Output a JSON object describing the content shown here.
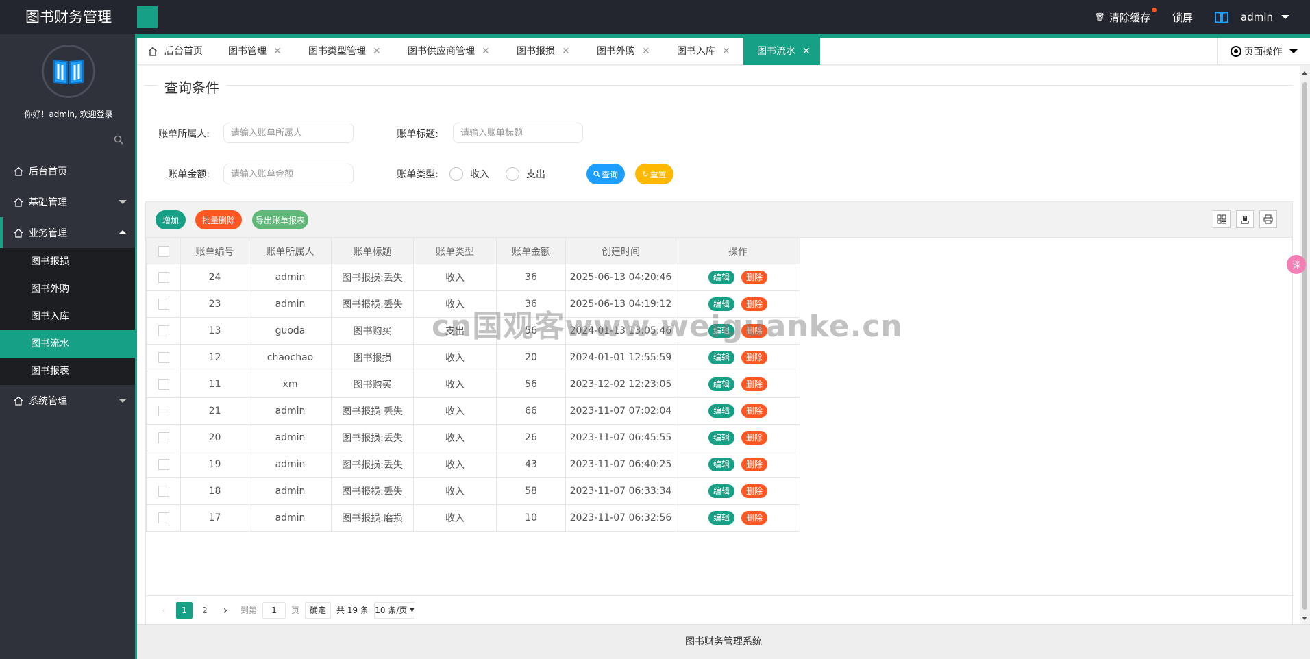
{
  "header": {
    "title": "图书财务管理",
    "clear_cache": "清除缓存",
    "lock_screen": "锁屏",
    "user": "admin"
  },
  "sidebar": {
    "welcome": "你好！admin, 欢迎登录",
    "menu": {
      "home": "后台首页",
      "basic": "基础管理",
      "business": "业务管理",
      "children": [
        "图书报损",
        "图书外购",
        "图书入库",
        "图书流水",
        "图书报表"
      ],
      "system": "系统管理"
    }
  },
  "tabs": [
    "后台首页",
    "图书管理",
    "图书类型管理",
    "图书供应商管理",
    "图书报损",
    "图书外购",
    "图书入库",
    "图书流水"
  ],
  "page_op": "页面操作",
  "query": {
    "legend": "查询条件",
    "owner_label": "账单所属人:",
    "owner_placeholder": "请输入账单所属人",
    "title_label": "账单标题:",
    "title_placeholder": "请输入账单标题",
    "amount_label": "账单金额:",
    "amount_placeholder": "请输入账单金额",
    "type_label": "账单类型:",
    "type_in": "收入",
    "type_out": "支出",
    "search_btn": "查询",
    "reset_btn": "重置"
  },
  "toolbar": {
    "add": "增加",
    "batch_delete": "批量删除",
    "export": "导出账单报表"
  },
  "table": {
    "columns": [
      "账单编号",
      "账单所属人",
      "账单标题",
      "账单类型",
      "账单金额",
      "创建时间",
      "操作"
    ],
    "edit_label": "编辑",
    "delete_label": "删除",
    "rows": [
      {
        "id": "24",
        "owner": "admin",
        "title": "图书报损:丢失",
        "type": "收入",
        "amount": "36",
        "time": "2025-06-13 04:20:46"
      },
      {
        "id": "23",
        "owner": "admin",
        "title": "图书报损:丢失",
        "type": "收入",
        "amount": "36",
        "time": "2025-06-13 04:19:12"
      },
      {
        "id": "13",
        "owner": "guoda",
        "title": "图书购买",
        "type": "支出",
        "amount": "56",
        "time": "2024-01-13 13:05:46"
      },
      {
        "id": "12",
        "owner": "chaochao",
        "title": "图书报损",
        "type": "收入",
        "amount": "20",
        "time": "2024-01-01 12:55:59"
      },
      {
        "id": "11",
        "owner": "xm",
        "title": "图书购买",
        "type": "收入",
        "amount": "56",
        "time": "2023-12-02 12:23:05"
      },
      {
        "id": "21",
        "owner": "admin",
        "title": "图书报损:丢失",
        "type": "收入",
        "amount": "66",
        "time": "2023-11-07 07:02:04"
      },
      {
        "id": "20",
        "owner": "admin",
        "title": "图书报损:丢失",
        "type": "收入",
        "amount": "26",
        "time": "2023-11-07 06:45:55"
      },
      {
        "id": "19",
        "owner": "admin",
        "title": "图书报损:丢失",
        "type": "收入",
        "amount": "43",
        "time": "2023-11-07 06:40:25"
      },
      {
        "id": "18",
        "owner": "admin",
        "title": "图书报损:丢失",
        "type": "收入",
        "amount": "58",
        "time": "2023-11-07 06:33:34"
      },
      {
        "id": "17",
        "owner": "admin",
        "title": "图书报损:磨损",
        "type": "收入",
        "amount": "10",
        "time": "2023-11-07 06:32:56"
      }
    ]
  },
  "pager": {
    "page1": "1",
    "page2": "2",
    "goto": "到第",
    "goto_value": "1",
    "page_unit": "页",
    "confirm": "确定",
    "total": "共 19 条",
    "per_page": "10 条/页"
  },
  "footer": "图书财务管理系统",
  "watermark": "cn国观客www.weiguanke.cn",
  "colors": {
    "primary": "#16a085",
    "danger": "#ff5722",
    "warm": "#ffb800",
    "info": "#1e9fff",
    "dark": "#23262e"
  }
}
